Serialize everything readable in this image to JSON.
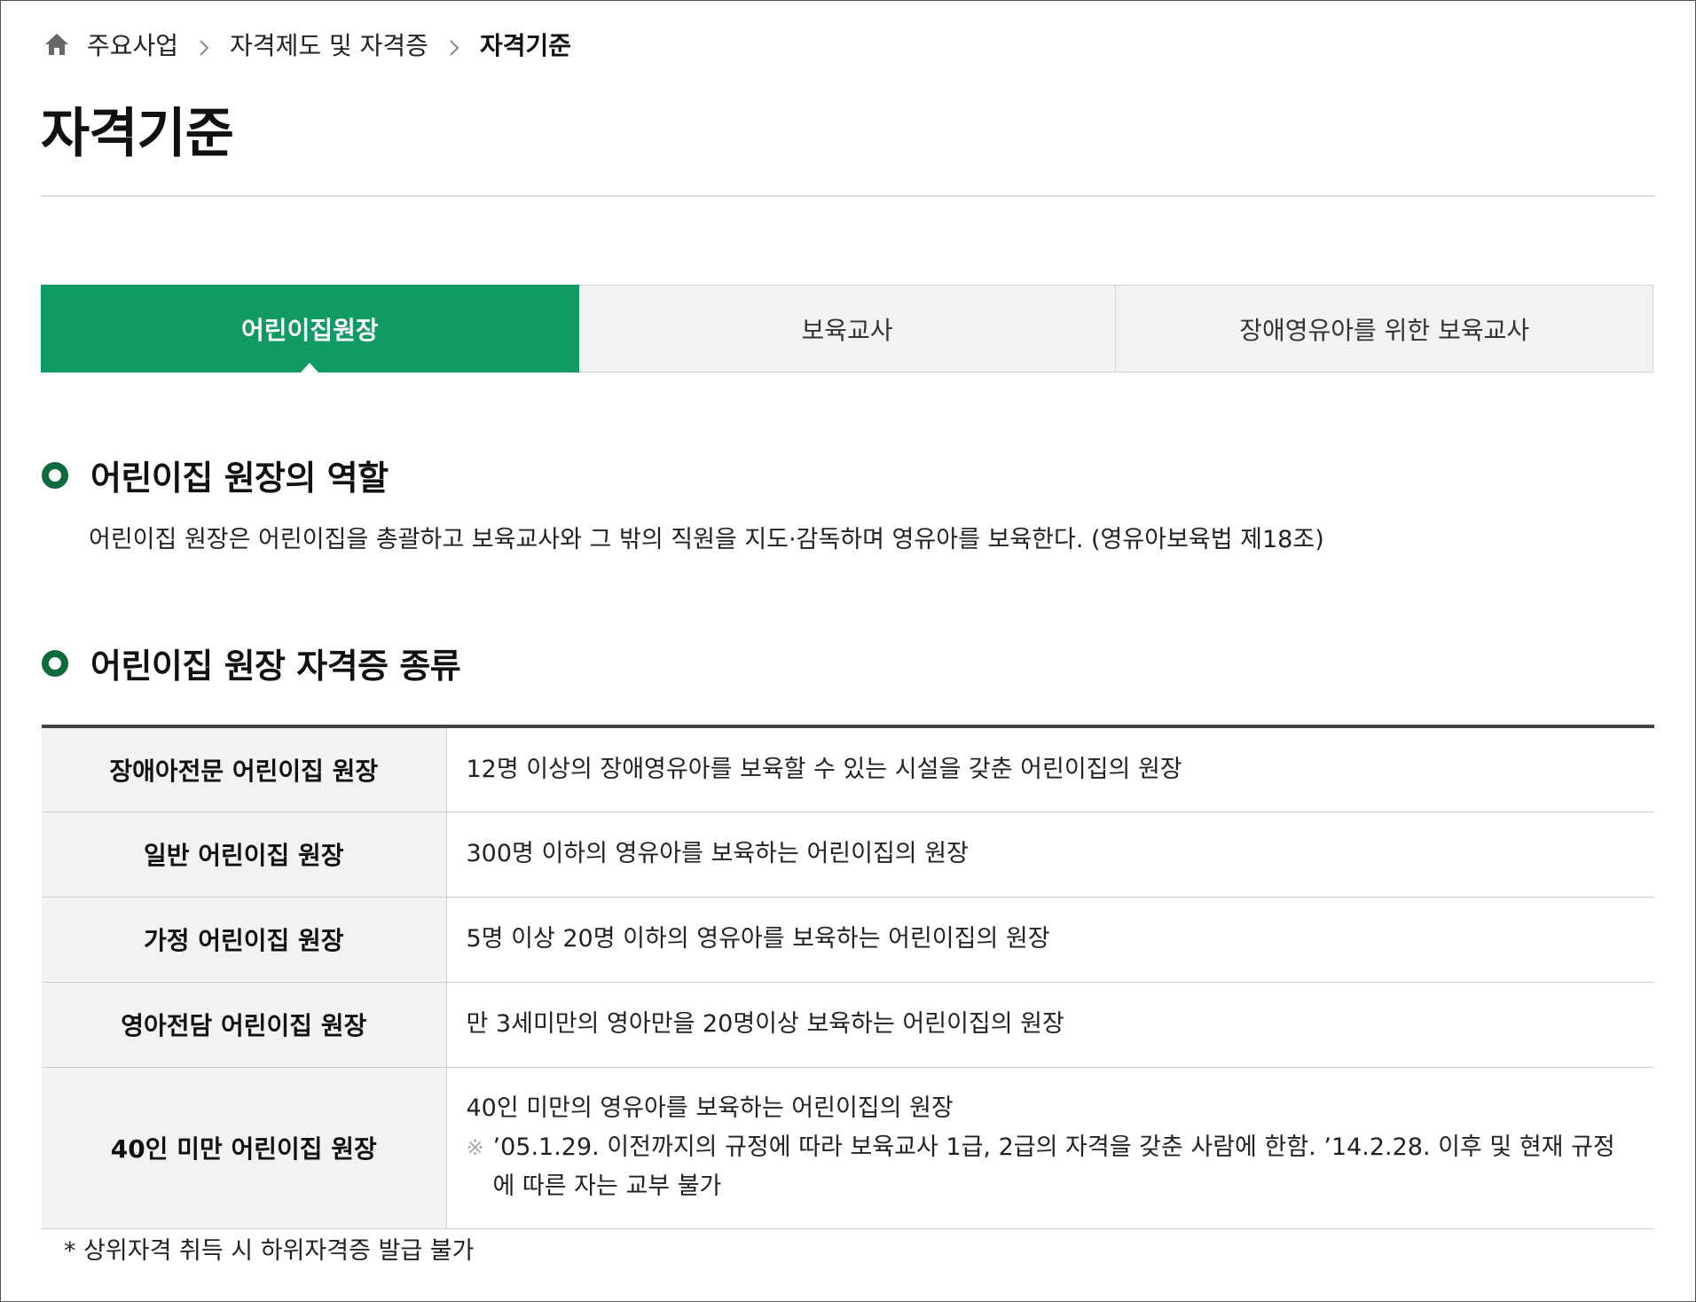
{
  "breadcrumb": {
    "items": [
      "주요사업",
      "자격제도 및 자격증"
    ],
    "current": "자격기준"
  },
  "page_title": "자격기준",
  "tabs": [
    {
      "label": "어린이집원장",
      "active": true
    },
    {
      "label": "보육교사",
      "active": false
    },
    {
      "label": "장애영유아를 위한 보육교사",
      "active": false
    }
  ],
  "section_role": {
    "heading": "어린이집 원장의 역할",
    "description": "어린이집 원장은 어린이집을 총괄하고 보육교사와 그 밖의 직원을 지도·감독하며 영유아를 보육한다. (영유아보육법 제18조)"
  },
  "section_types": {
    "heading": "어린이집 원장 자격증 종류",
    "rows": [
      {
        "name": "장애아전문 어린이집 원장",
        "desc": "12명 이상의 장애영유아를 보육할 수 있는 시설을 갖춘 어린이집의 원장"
      },
      {
        "name": "일반 어린이집 원장",
        "desc": "300명 이하의 영유아를 보육하는 어린이집의 원장"
      },
      {
        "name": "가정 어린이집 원장",
        "desc": "5명 이상 20명 이하의 영유아를 보육하는 어린이집의 원장"
      },
      {
        "name": "영아전담 어린이집 원장",
        "desc": "만 3세미만의 영아만을 20명이상 보육하는 어린이집의 원장"
      },
      {
        "name": "40인 미만 어린이집 원장",
        "desc": "40인 미만의 영유아를 보육하는 어린이집의 원장",
        "note_mark": "※",
        "note": "’05.1.29. 이전까지의 규정에 따라 보육교사 1급, 2급의 자격을 갖춘 사람에 한함. ’14.2.28. 이후 및 현재 규정에 따른 자는 교부 불가"
      }
    ]
  },
  "footnote": "* 상위자격 취득 시 하위자격증 발급 불가",
  "colors": {
    "accent": "#129a63",
    "bullet": "#0b6b3a",
    "tab_bg": "#f2f2f2",
    "table_top": "#444444"
  },
  "icons": {
    "home": "home-icon",
    "separator": "chevron-right-icon",
    "bullet": "ring-bullet-icon",
    "note": "reference-mark-icon"
  }
}
